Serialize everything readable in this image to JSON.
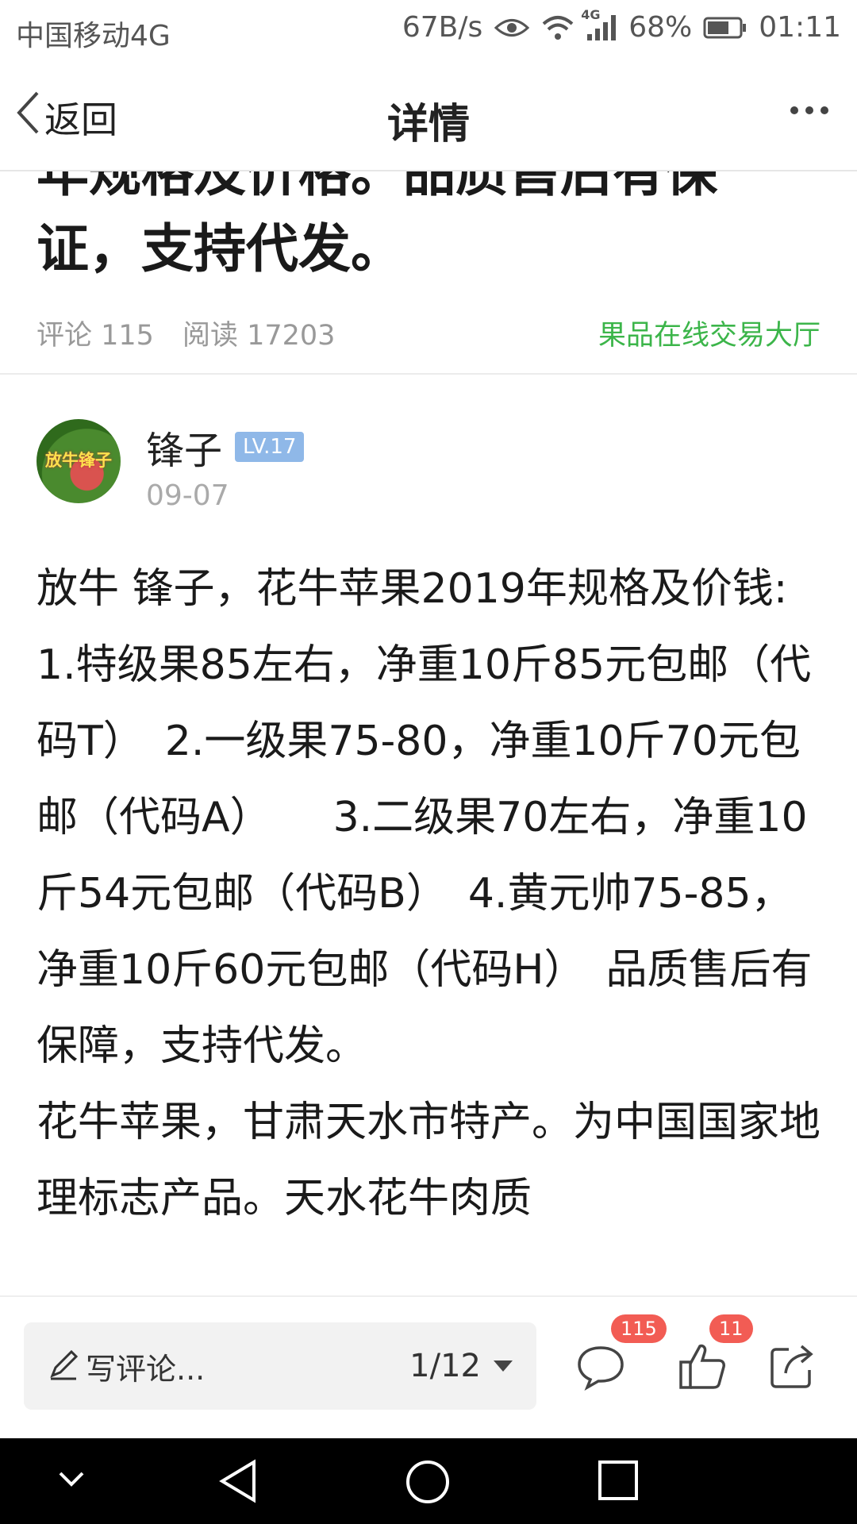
{
  "status_bar": {
    "carrier": "中国移动4G",
    "speed": "67B/s",
    "network_label": "4G",
    "battery": "68%",
    "time": "01:11",
    "battery_level": 0.68
  },
  "nav": {
    "back_label": "返回",
    "title": "详情"
  },
  "article": {
    "title_lines": [
      "年规格及价格。品质售后有保",
      "证，支持代发。"
    ],
    "comments_label": "评论 115",
    "reads_label": "阅读 17203",
    "channel_link": "果品在线交易大厅"
  },
  "author": {
    "name": "锋子",
    "level": "LV.17",
    "date": "09-07",
    "avatar_text": "放牛锋子"
  },
  "body": {
    "paragraph_1": "放牛 锋子，花牛苹果2019年规格及价钱:　　1.特级果85左右，净重10斤85元包邮（代码T）　2.一级果75-80，净重10斤70元包邮（代码A）　　3.二级果70左右，净重10斤54元包邮（代码B）　4.黄元帅75-85，净重10斤60元包邮（代码H）　品质售后有保障，支持代发。",
    "paragraph_2": "花牛苹果，甘肃天水市特产。为中国国家地理标志产品。天水花牛肉质"
  },
  "bottom_bar": {
    "comment_placeholder": "写评论...",
    "page_indicator": "1/12",
    "comment_count": "115",
    "like_count": "11"
  },
  "icons": {
    "back": "chevron-left-icon",
    "more": "more-dots-icon",
    "pencil": "pencil-icon",
    "dropdown": "triangle-down-icon",
    "comment": "speech-bubble-icon",
    "like": "thumbs-up-icon",
    "share": "share-icon",
    "eye": "eye-icon",
    "wifi": "wifi-icon",
    "signal": "signal-icon",
    "battery": "battery-icon"
  },
  "colors": {
    "accent_green": "#3cb54a",
    "badge_red": "#f25c54",
    "level_badge": "#8fb8e8"
  }
}
